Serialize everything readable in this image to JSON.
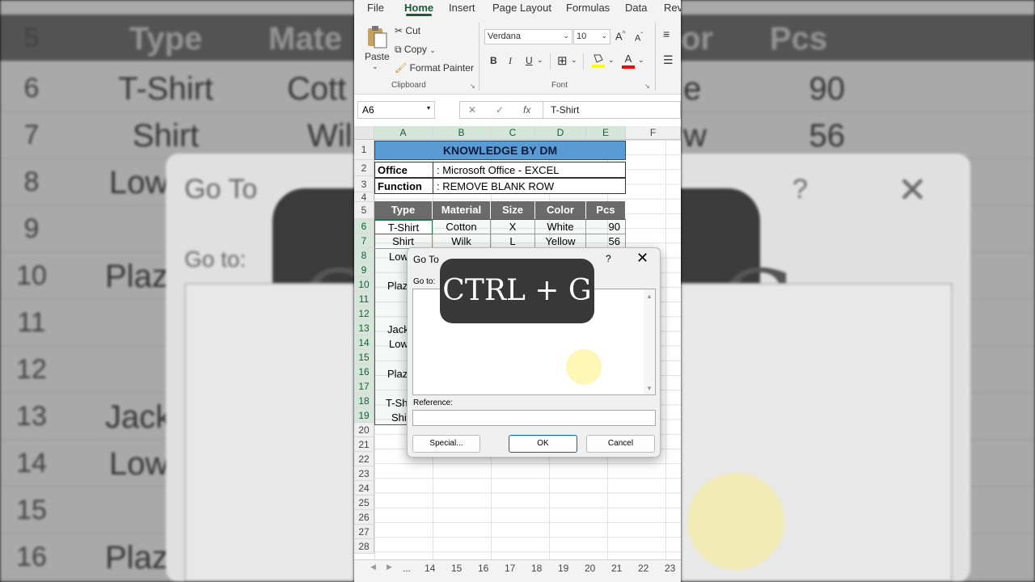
{
  "ribbon_tabs": [
    "File",
    "Home",
    "Insert",
    "Page Layout",
    "Formulas",
    "Data",
    "Revi"
  ],
  "clipboard": {
    "paste": "Paste",
    "cut": "Cut",
    "copy": "Copy",
    "format_painter": "Format Painter",
    "label": "Clipboard"
  },
  "font": {
    "name": "Verdana",
    "size": "10",
    "label": "Font",
    "bold": "B",
    "italic": "I",
    "underline": "U"
  },
  "formula_bar": {
    "name_box": "A6",
    "content": "T-Shirt",
    "fx": "fx"
  },
  "columns": [
    "A",
    "B",
    "C",
    "D",
    "E",
    "F"
  ],
  "rows": [
    "1",
    "2",
    "3",
    "4",
    "5",
    "6",
    "7",
    "8",
    "9",
    "10",
    "11",
    "12",
    "13",
    "14",
    "15",
    "16",
    "17",
    "18",
    "19",
    "20",
    "21",
    "22",
    "23",
    "24",
    "25",
    "26",
    "27",
    "28"
  ],
  "sheet": {
    "title": "KNOWLEDGE BY DM",
    "office_key": "Office",
    "office_val": ": Microsoft Office - EXCEL",
    "function_key": "Function",
    "function_val": ": REMOVE BLANK ROW",
    "headers": [
      "Type",
      "Material",
      "Size",
      "Color",
      "Pcs"
    ],
    "row6": [
      "T-Shirt",
      "Cotton",
      "X",
      "White",
      "90"
    ],
    "row7": [
      "Shirt",
      "Wilk",
      "L",
      "Yellow",
      "56"
    ],
    "partial": {
      "r8": "Low",
      "r10": "Plaz",
      "r13": "Jack",
      "r14": "Low",
      "r16": "Plaz",
      "r18": "T-Sh",
      "r19": "Shi"
    }
  },
  "sheetbar": {
    "dots": "...",
    "tabs": [
      "14",
      "15",
      "16",
      "17",
      "18",
      "19",
      "20",
      "21",
      "22",
      "23"
    ]
  },
  "dialog": {
    "title": "Go To",
    "help": "?",
    "goto_label": "Go to:",
    "reference_label": "Reference:",
    "reference_value": "",
    "special_button": "Special...",
    "ok_button": "OK",
    "cancel_button": "Cancel"
  },
  "badge": {
    "text": "CTRL + G"
  },
  "background": {
    "rownums": [
      "5",
      "6",
      "7",
      "8",
      "9",
      "10",
      "11",
      "12",
      "13",
      "14",
      "15",
      "16"
    ],
    "left_header": "Type",
    "left_header2": "Mate",
    "right_header": "Pcs",
    "right_header2": "or",
    "left_cells": [
      "T-Shirt",
      "Shirt",
      "Low",
      "",
      "Plaz",
      "",
      "",
      "Jack",
      "Low",
      "",
      "Plaz"
    ],
    "left_cells2": [
      "Cott",
      "Wil"
    ],
    "right_vals": [
      "90",
      "56"
    ],
    "right_cells2": [
      "e",
      "w"
    ],
    "dialog_title": "Go To",
    "dialog_goto": "Go to:",
    "badge_text": "CTRL + G"
  },
  "colors": {
    "excel_green": "#185c37",
    "title_fill": "#5b9bd5",
    "header_fill": "#6b6b6b"
  }
}
